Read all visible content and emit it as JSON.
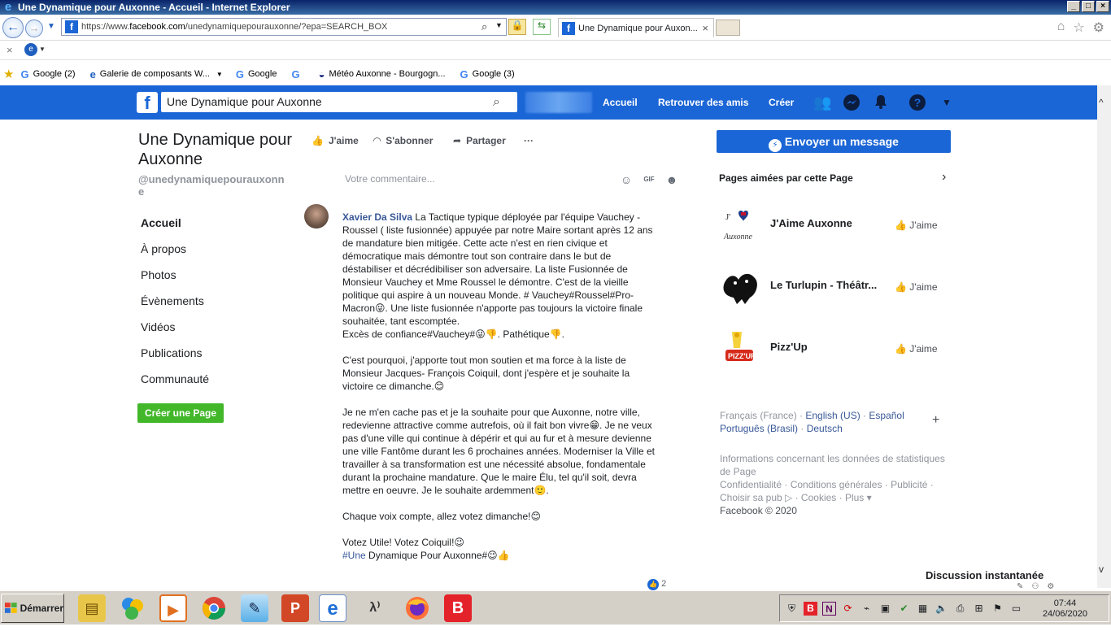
{
  "window": {
    "title": "Une Dynamique pour Auxonne - Accueil - Internet Explorer",
    "url_prefix": "https://www.",
    "url_domain": "facebook.com",
    "url_rest": "/unedynamiquepourauxonne/?epa=SEARCH_BOX",
    "tab_title": "Une Dynamique pour Auxon...",
    "tab_close": "×"
  },
  "favorites": [
    {
      "label": "Google (2)",
      "icon": "G"
    },
    {
      "label": "Galerie de composants W...",
      "icon": "e"
    },
    {
      "label": "Google",
      "icon": "G"
    },
    {
      "label": "",
      "icon": "G"
    },
    {
      "label": "Météo Auxonne - Bourgogn...",
      "icon": "~"
    },
    {
      "label": "Google (3)",
      "icon": "G"
    }
  ],
  "fb": {
    "search_value": "Une Dynamique pour Auxonne",
    "nav_home": "Accueil",
    "nav_friends": "Retrouver des amis",
    "nav_create": "Créer"
  },
  "page": {
    "name": "Une Dynamique pour Auxonne",
    "handle": "@unedynamiquepourauxonne",
    "nav": [
      "Accueil",
      "À propos",
      "Photos",
      "Évènements",
      "Vidéos",
      "Publications",
      "Communauté"
    ],
    "create_page": "Créer une Page"
  },
  "actions": {
    "like": "J'aime",
    "follow": "S'abonner",
    "share": "Partager",
    "more": "···"
  },
  "comment": {
    "placeholder": "Votre commentaire..."
  },
  "post": {
    "author": "Xavier Da Silva",
    "p1": " La Tactique typique déployée par l'équipe Vauchey - Roussel ( liste fusionnée) appuyée par notre Maire sortant après 12 ans de mandature bien mitigée. Cette acte n'est en rien civique et démocratique mais démontre tout son contraire dans le but de déstabiliser et décrédibiliser son adversaire. La liste Fusionnée de Monsieur Vauchey et Mme Roussel le démontre. C'est de la vieille politique qui aspire à un nouveau Monde. # Vauchey#Roussel#Pro-Macron😜. Une liste fusionnée n'apporte pas toujours la victoire finale souhaitée, tant escomptée.",
    "p1b": "Excès de confiance#Vauchey#😜👎. Pathétique👎.",
    "p2": "C'est pourquoi, j'apporte tout mon soutien et ma force à la liste de Monsieur Jacques- François Coiquil, dont j'espère et je souhaite la victoire ce dimanche.😊",
    "p3": "Je ne m'en cache pas et je la souhaite pour que Auxonne, notre ville, redevienne attractive comme autrefois, où il fait bon vivre😁. Je ne veux pas d'une ville qui continue à dépérir et qui au fur et à mesure devienne une ville Fantôme durant les 6 prochaines années. Moderniser la Ville et travailler à sa transformation est une nécessité absolue, fondamentale durant la prochaine mandature. Que le maire Élu, tel qu'il soit, devra mettre en oeuvre. Je le souhaite ardemment🙂.",
    "p4": "Chaque voix compte, allez votez dimanche!😊",
    "p5": "Votez Utile! Votez Coiquil!😉",
    "p6_tag": "#Une",
    "p6_rest": " Dynamique Pour Auxonne#😉👍",
    "like_count": "2"
  },
  "right": {
    "send_message": "Envoyer un message",
    "liked_title": "Pages aimées par cette Page",
    "liked": [
      {
        "name": "J'Aime Auxonne",
        "like": "J'aime"
      },
      {
        "name": "Le Turlupin - Théâtr...",
        "like": "J'aime"
      },
      {
        "name": "Pizz'Up",
        "like": "J'aime"
      }
    ],
    "lang_current": "Français (France)",
    "lang_sep": " · ",
    "langs": [
      "English (US)",
      "Español",
      "Português (Brasil)",
      "Deutsch"
    ],
    "footer1": "Informations concernant les données de statistiques de Page",
    "footer2": "Confidentialité · Conditions générales · Publicité · Choisir sa pub ▷ · Cookies · Plus ▾",
    "copyright": "Facebook © 2020",
    "chat": "Discussion instantanée"
  },
  "taskbar": {
    "start": "Démarrer",
    "time": "07:44",
    "date": "24/06/2020"
  }
}
